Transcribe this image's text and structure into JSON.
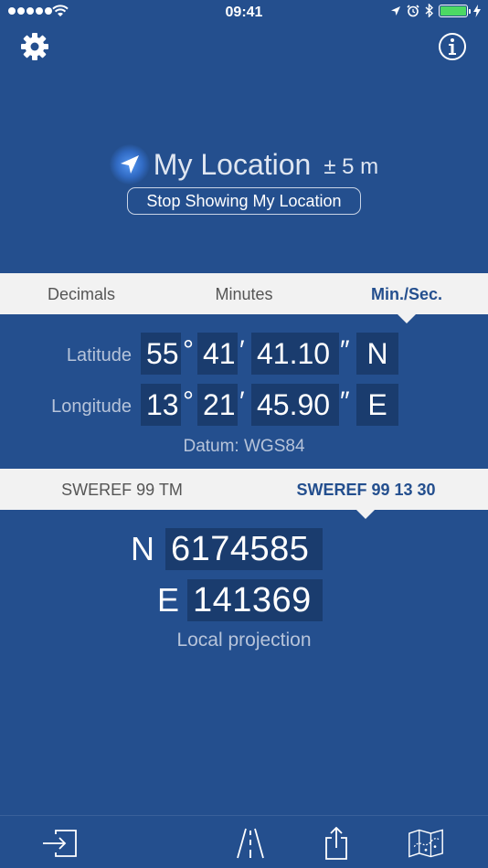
{
  "status_bar": {
    "time": "09:41",
    "signal_dots": 5,
    "battery_level": 1.0,
    "icons": [
      "signal-dots",
      "wifi-icon",
      "location-arrow-icon",
      "alarm-icon",
      "bluetooth-icon",
      "battery-icon",
      "charging-icon"
    ]
  },
  "header": {
    "settings_icon": "gear-icon",
    "info_icon": "info-icon"
  },
  "location": {
    "title": "My Location",
    "accuracy": "± 5 m",
    "stop_button": "Stop Showing My Location",
    "icon": "location-arrow-icon"
  },
  "format_tabs": {
    "items": [
      {
        "label": "Decimals"
      },
      {
        "label": "Minutes"
      },
      {
        "label": "Min./Sec."
      }
    ],
    "selected": "Min./Sec."
  },
  "latitude": {
    "label": "Latitude",
    "degrees": "55",
    "minutes": "41",
    "seconds": "41.10",
    "hemisphere": "N"
  },
  "longitude": {
    "label": "Longitude",
    "degrees": "13",
    "minutes": "21",
    "seconds": "45.90",
    "hemisphere": "E"
  },
  "symbols": {
    "degree": "°",
    "minute": "′",
    "second": "″"
  },
  "datum": "Datum: WGS84",
  "grid_tabs": {
    "items": [
      {
        "label": "SWEREF 99 TM"
      },
      {
        "label": "SWEREF 99 13 30"
      }
    ],
    "selected": "SWEREF 99 13 30"
  },
  "grid": {
    "north_label": "N",
    "north_value": "6174585",
    "east_label": "E",
    "east_value": "141369",
    "caption": "Local projection"
  },
  "toolbar": {
    "items": [
      "enter-coordinates-icon",
      "road-icon",
      "share-icon",
      "map-icon"
    ]
  },
  "colors": {
    "background": "#244f8e",
    "box": "#1a3c6e",
    "tab_bar": "#f2f2f2",
    "accent": "#244f8e",
    "label": "#b7c4da"
  }
}
